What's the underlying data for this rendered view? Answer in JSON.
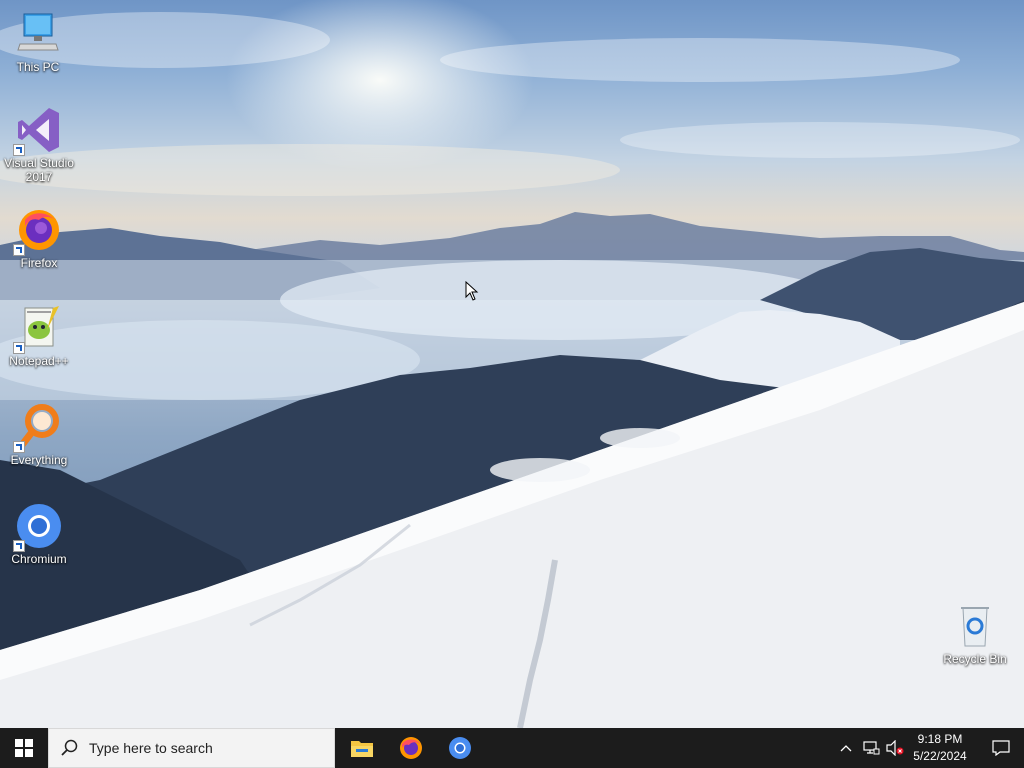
{
  "desktop": {
    "icons": [
      {
        "name": "this-pc",
        "label": "This PC"
      },
      {
        "name": "visual-studio",
        "label": "Visual Studio 2017"
      },
      {
        "name": "firefox",
        "label": "Firefox"
      },
      {
        "name": "notepadpp",
        "label": "Notepad++"
      },
      {
        "name": "everything",
        "label": "Everything"
      },
      {
        "name": "chromium",
        "label": "Chromium"
      },
      {
        "name": "recycle-bin",
        "label": "Recycle Bin"
      }
    ]
  },
  "taskbar": {
    "search_placeholder": "Type here to search",
    "pinned_apps": [
      "file-explorer",
      "firefox",
      "chromium"
    ],
    "clock": {
      "time": "9:18 PM",
      "date": "5/22/2024"
    }
  },
  "colors": {
    "taskbar_bg": "#1c1c1c",
    "search_bg": "#f3f3f3",
    "windows_blue": "#0078d7"
  }
}
